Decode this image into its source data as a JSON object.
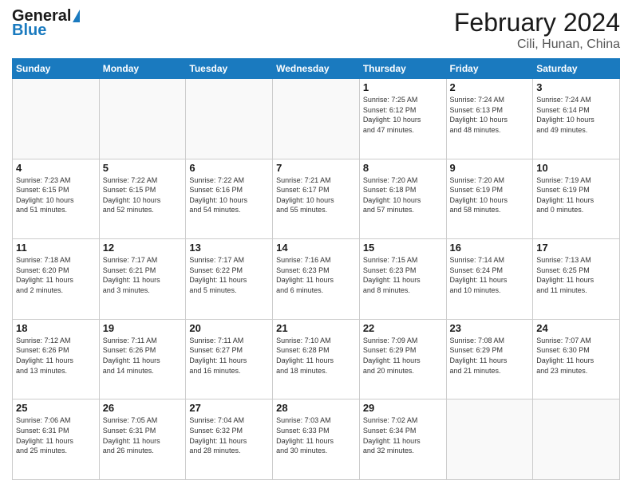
{
  "header": {
    "logo_line1": "General",
    "logo_line2": "Blue",
    "title": "February 2024",
    "subtitle": "Cili, Hunan, China"
  },
  "days_of_week": [
    "Sunday",
    "Monday",
    "Tuesday",
    "Wednesday",
    "Thursday",
    "Friday",
    "Saturday"
  ],
  "weeks": [
    [
      {
        "day": "",
        "info": ""
      },
      {
        "day": "",
        "info": ""
      },
      {
        "day": "",
        "info": ""
      },
      {
        "day": "",
        "info": ""
      },
      {
        "day": "1",
        "info": "Sunrise: 7:25 AM\nSunset: 6:12 PM\nDaylight: 10 hours\nand 47 minutes."
      },
      {
        "day": "2",
        "info": "Sunrise: 7:24 AM\nSunset: 6:13 PM\nDaylight: 10 hours\nand 48 minutes."
      },
      {
        "day": "3",
        "info": "Sunrise: 7:24 AM\nSunset: 6:14 PM\nDaylight: 10 hours\nand 49 minutes."
      }
    ],
    [
      {
        "day": "4",
        "info": "Sunrise: 7:23 AM\nSunset: 6:15 PM\nDaylight: 10 hours\nand 51 minutes."
      },
      {
        "day": "5",
        "info": "Sunrise: 7:22 AM\nSunset: 6:15 PM\nDaylight: 10 hours\nand 52 minutes."
      },
      {
        "day": "6",
        "info": "Sunrise: 7:22 AM\nSunset: 6:16 PM\nDaylight: 10 hours\nand 54 minutes."
      },
      {
        "day": "7",
        "info": "Sunrise: 7:21 AM\nSunset: 6:17 PM\nDaylight: 10 hours\nand 55 minutes."
      },
      {
        "day": "8",
        "info": "Sunrise: 7:20 AM\nSunset: 6:18 PM\nDaylight: 10 hours\nand 57 minutes."
      },
      {
        "day": "9",
        "info": "Sunrise: 7:20 AM\nSunset: 6:19 PM\nDaylight: 10 hours\nand 58 minutes."
      },
      {
        "day": "10",
        "info": "Sunrise: 7:19 AM\nSunset: 6:19 PM\nDaylight: 11 hours\nand 0 minutes."
      }
    ],
    [
      {
        "day": "11",
        "info": "Sunrise: 7:18 AM\nSunset: 6:20 PM\nDaylight: 11 hours\nand 2 minutes."
      },
      {
        "day": "12",
        "info": "Sunrise: 7:17 AM\nSunset: 6:21 PM\nDaylight: 11 hours\nand 3 minutes."
      },
      {
        "day": "13",
        "info": "Sunrise: 7:17 AM\nSunset: 6:22 PM\nDaylight: 11 hours\nand 5 minutes."
      },
      {
        "day": "14",
        "info": "Sunrise: 7:16 AM\nSunset: 6:23 PM\nDaylight: 11 hours\nand 6 minutes."
      },
      {
        "day": "15",
        "info": "Sunrise: 7:15 AM\nSunset: 6:23 PM\nDaylight: 11 hours\nand 8 minutes."
      },
      {
        "day": "16",
        "info": "Sunrise: 7:14 AM\nSunset: 6:24 PM\nDaylight: 11 hours\nand 10 minutes."
      },
      {
        "day": "17",
        "info": "Sunrise: 7:13 AM\nSunset: 6:25 PM\nDaylight: 11 hours\nand 11 minutes."
      }
    ],
    [
      {
        "day": "18",
        "info": "Sunrise: 7:12 AM\nSunset: 6:26 PM\nDaylight: 11 hours\nand 13 minutes."
      },
      {
        "day": "19",
        "info": "Sunrise: 7:11 AM\nSunset: 6:26 PM\nDaylight: 11 hours\nand 14 minutes."
      },
      {
        "day": "20",
        "info": "Sunrise: 7:11 AM\nSunset: 6:27 PM\nDaylight: 11 hours\nand 16 minutes."
      },
      {
        "day": "21",
        "info": "Sunrise: 7:10 AM\nSunset: 6:28 PM\nDaylight: 11 hours\nand 18 minutes."
      },
      {
        "day": "22",
        "info": "Sunrise: 7:09 AM\nSunset: 6:29 PM\nDaylight: 11 hours\nand 20 minutes."
      },
      {
        "day": "23",
        "info": "Sunrise: 7:08 AM\nSunset: 6:29 PM\nDaylight: 11 hours\nand 21 minutes."
      },
      {
        "day": "24",
        "info": "Sunrise: 7:07 AM\nSunset: 6:30 PM\nDaylight: 11 hours\nand 23 minutes."
      }
    ],
    [
      {
        "day": "25",
        "info": "Sunrise: 7:06 AM\nSunset: 6:31 PM\nDaylight: 11 hours\nand 25 minutes."
      },
      {
        "day": "26",
        "info": "Sunrise: 7:05 AM\nSunset: 6:31 PM\nDaylight: 11 hours\nand 26 minutes."
      },
      {
        "day": "27",
        "info": "Sunrise: 7:04 AM\nSunset: 6:32 PM\nDaylight: 11 hours\nand 28 minutes."
      },
      {
        "day": "28",
        "info": "Sunrise: 7:03 AM\nSunset: 6:33 PM\nDaylight: 11 hours\nand 30 minutes."
      },
      {
        "day": "29",
        "info": "Sunrise: 7:02 AM\nSunset: 6:34 PM\nDaylight: 11 hours\nand 32 minutes."
      },
      {
        "day": "",
        "info": ""
      },
      {
        "day": "",
        "info": ""
      }
    ]
  ]
}
